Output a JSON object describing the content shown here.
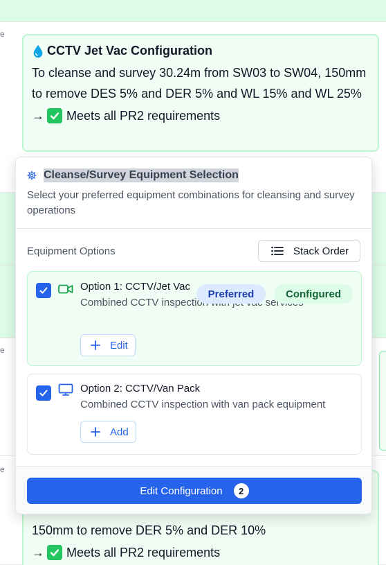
{
  "background": {
    "row_edge_char": "e",
    "top_card": {
      "title": "CCTV Jet Vac Configuration",
      "description": "To cleanse and survey 30.24m from SW03 to SW04, 150mm to remove DES 5% and DER 5% and WL 15% and WL 25%",
      "status_arrow": "→",
      "status": "Meets all PR2 requirements"
    },
    "bottom_card": {
      "description": "150mm to remove DER 5% and DER 10%",
      "status_arrow": "→",
      "status": "Meets all PR2 requirements"
    }
  },
  "panel": {
    "title": "Cleanse/Survey Equipment Selection",
    "subtitle": "Select your preferred equipment combinations for cleansing and survey operations",
    "options_label": "Equipment Options",
    "stack_order_label": "Stack Order",
    "options": [
      {
        "name": "Option 1: CCTV/Jet Vac",
        "description": "Combined CCTV inspection with jet vac services",
        "badge_preferred": "Preferred",
        "badge_configured": "Configured",
        "action_label": "Edit",
        "checked": true
      },
      {
        "name": "Option 2: CCTV/Van Pack",
        "description": "Combined CCTV inspection with van pack equipment",
        "action_label": "Add",
        "checked": true
      }
    ],
    "primary_button_label": "Edit Configuration",
    "primary_button_count": "2"
  },
  "colors": {
    "accent": "#2563eb",
    "success": "#22c55e",
    "success_bg": "#f0fdf4",
    "success_border": "#bbf7d0"
  }
}
